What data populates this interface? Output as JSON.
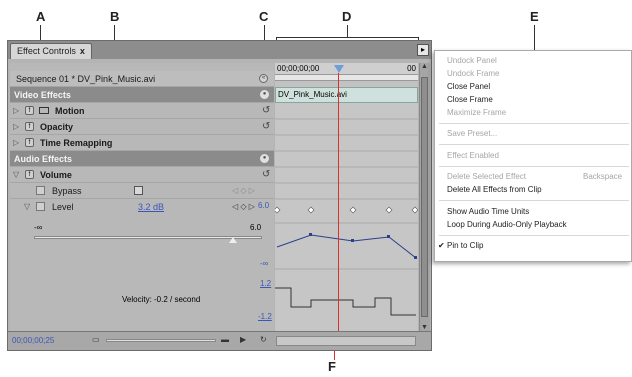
{
  "callouts": [
    "A",
    "B",
    "C",
    "D",
    "E",
    "F"
  ],
  "panel": {
    "tab_label": "Effect Controls",
    "tab_close": "x",
    "flyout_glyph": "▸",
    "sequence_label": "Sequence 01 * DV_Pink_Music.avi",
    "timecode_start": "00;00;00;00",
    "timecode_end": "00",
    "clip_name": "DV_Pink_Music.avi",
    "video_effects": "Video Effects",
    "audio_effects": "Audio Effects",
    "motion": "Motion",
    "opacity": "Opacity",
    "time_remapping": "Time Remapping",
    "volume": "Volume",
    "bypass": "Bypass",
    "level": "Level",
    "level_value": "3.2 dB",
    "slider_min": "-∞",
    "slider_max": "6.0",
    "graph_top_value": "6.0",
    "graph_bottom_value": "-∞",
    "velocity_top": "1.2",
    "velocity_bottom": "-1.2",
    "velocity_text": "Velocity: -0.2 / second",
    "current_time": "00;00;00;25"
  },
  "menu": {
    "undock_panel": "Undock Panel",
    "undock_frame": "Undock Frame",
    "close_panel": "Close Panel",
    "close_frame": "Close Frame",
    "maximize_frame": "Maximize Frame",
    "save_preset": "Save Preset...",
    "effect_enabled": "Effect Enabled",
    "delete_selected": "Delete Selected Effect",
    "delete_shortcut": "Backspace",
    "delete_all": "Delete All Effects from Clip",
    "show_audio_units": "Show Audio Time Units",
    "loop_audio": "Loop During Audio-Only Playback",
    "pin_to_clip": "Pin to Clip"
  },
  "colors": {
    "playhead": "#d9322e",
    "clip_bar": "#cfe1dc",
    "graph_line": "#2c3f8a",
    "value_blue": "#3b57b8"
  }
}
